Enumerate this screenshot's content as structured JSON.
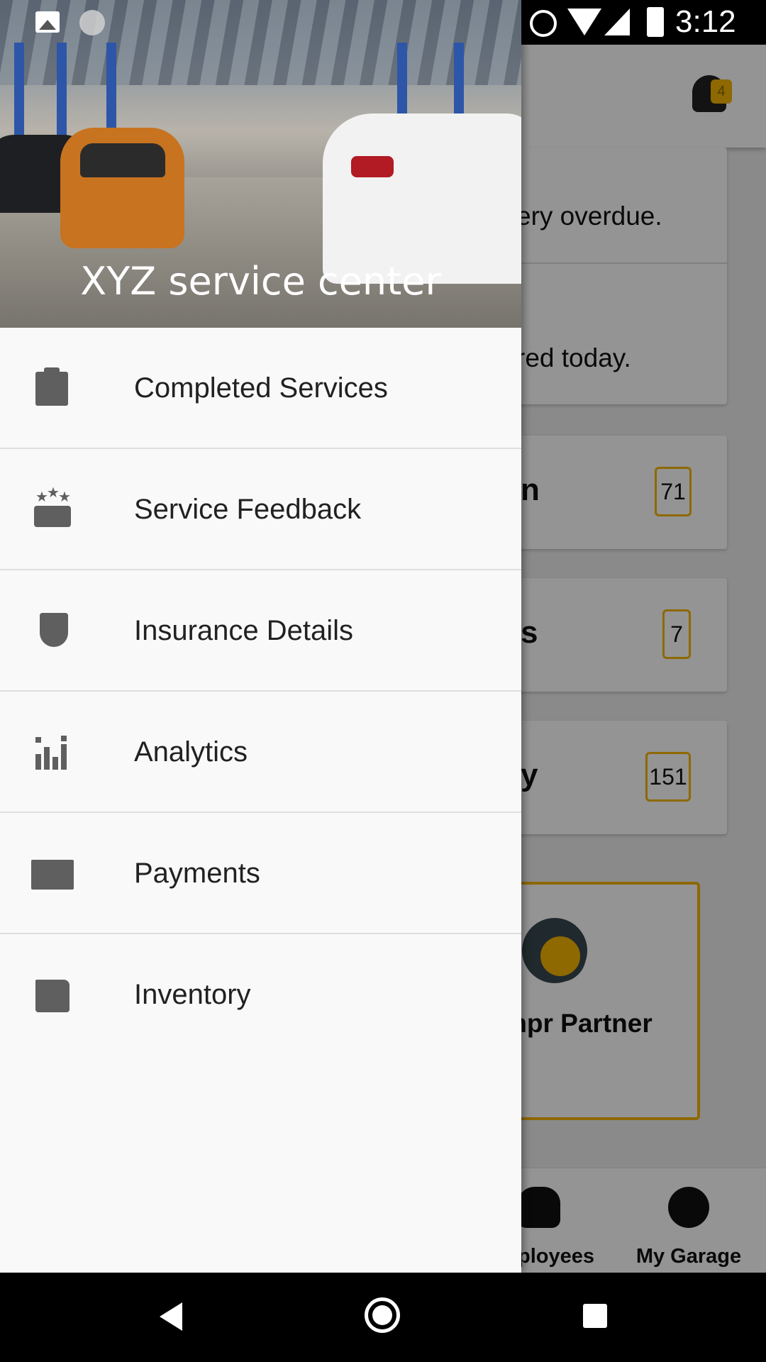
{
  "status_bar": {
    "time": "3:12",
    "icons": [
      "image-icon",
      "sync-icon",
      "alarm-icon",
      "wifi-icon",
      "signal-icon",
      "battery-charging-icon"
    ]
  },
  "background_app": {
    "notification_count": "4",
    "cards": [
      {
        "text": "ery overdue."
      },
      {
        "text": "red today."
      },
      {
        "title": "n",
        "count": "71"
      },
      {
        "title": "s",
        "count": "7"
      },
      {
        "title": "y",
        "count": "151"
      }
    ],
    "partner_label": "mpr Partner",
    "bottom_nav": [
      {
        "label": "ployees",
        "icon": "employees-icon"
      },
      {
        "label": "My Garage",
        "icon": "account-icon"
      }
    ]
  },
  "drawer": {
    "title": "XYZ service center",
    "items": [
      {
        "label": "Completed Services",
        "icon": "clipboard-icon"
      },
      {
        "label": "Service Feedback",
        "icon": "feedback-stars-icon"
      },
      {
        "label": "Insurance Details",
        "icon": "shield-icon"
      },
      {
        "label": "Analytics",
        "icon": "analytics-chart-icon"
      },
      {
        "label": "Payments",
        "icon": "wallet-icon"
      },
      {
        "label": "Inventory",
        "icon": "inventory-box-icon"
      }
    ]
  },
  "colors": {
    "accent": "#f4b400",
    "icon": "#5f5f5f",
    "drawer_bg": "#f9f9f9",
    "menu_text": "#212121"
  }
}
